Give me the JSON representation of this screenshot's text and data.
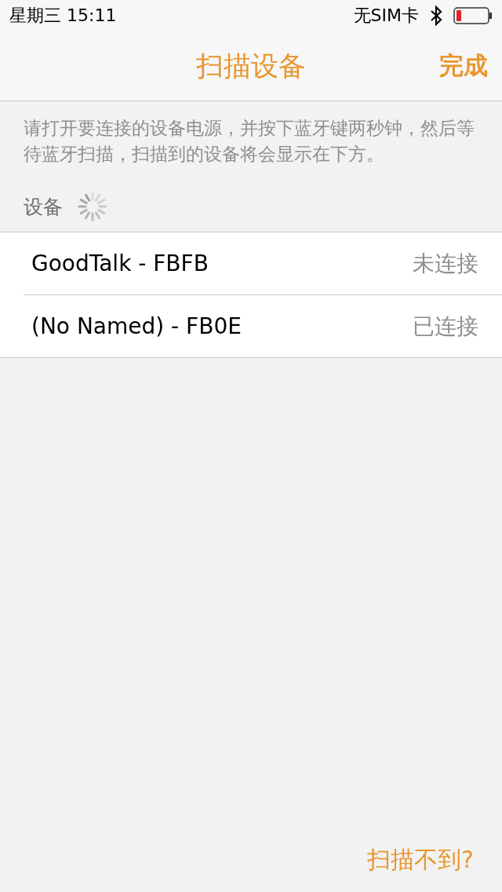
{
  "status_bar": {
    "time": "星期三 15:11",
    "carrier": "无SIM卡"
  },
  "nav": {
    "title": "扫描设备",
    "done": "完成"
  },
  "description": "请打开要连接的设备电源，并按下蓝牙键两秒钟，然后等待蓝牙扫描，扫描到的设备将会显示在下方。",
  "section": {
    "title": "设备",
    "scanning": true
  },
  "devices": [
    {
      "name": "GoodTalk - FBFB",
      "status": "未连接"
    },
    {
      "name": "(No Named) - FB0E",
      "status": "已连接"
    }
  ],
  "footer_link": "扫描不到?"
}
